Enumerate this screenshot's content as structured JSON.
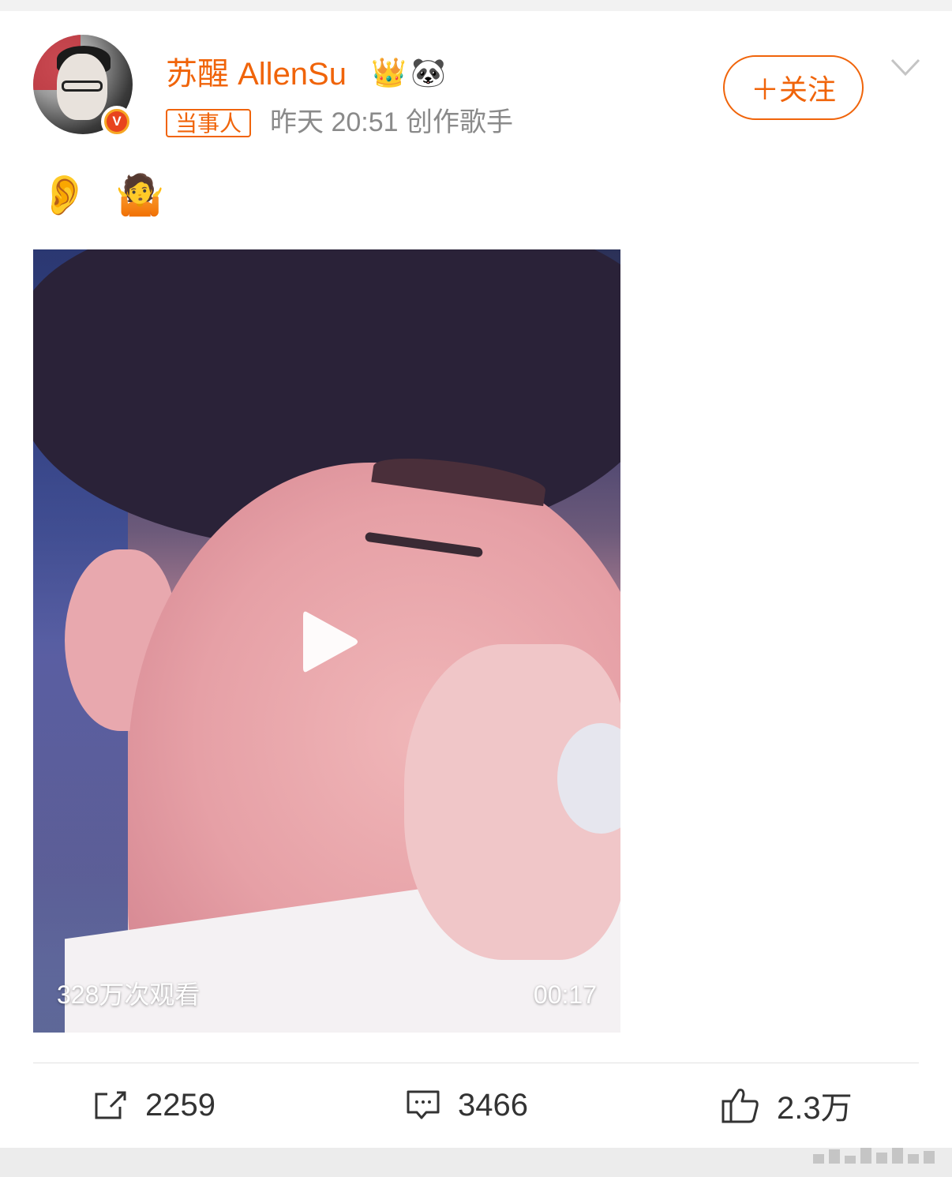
{
  "post": {
    "username": "苏醒 AllenSu",
    "tag": "当事人",
    "meta": "昨天 20:51 创作歌手",
    "follow_label": "＋关注",
    "emojis": [
      "👂",
      "🤷"
    ],
    "badges": [
      "crown-icon",
      "panda-icon"
    ],
    "verified_badge": "V"
  },
  "video": {
    "views": "328万次观看",
    "duration": "00:17"
  },
  "actions": {
    "share_count": "2259",
    "comment_count": "3466",
    "like_count": "2.3万"
  },
  "colors": {
    "accent": "#f0640a",
    "text": "#333333",
    "meta": "#8a8a8a"
  }
}
